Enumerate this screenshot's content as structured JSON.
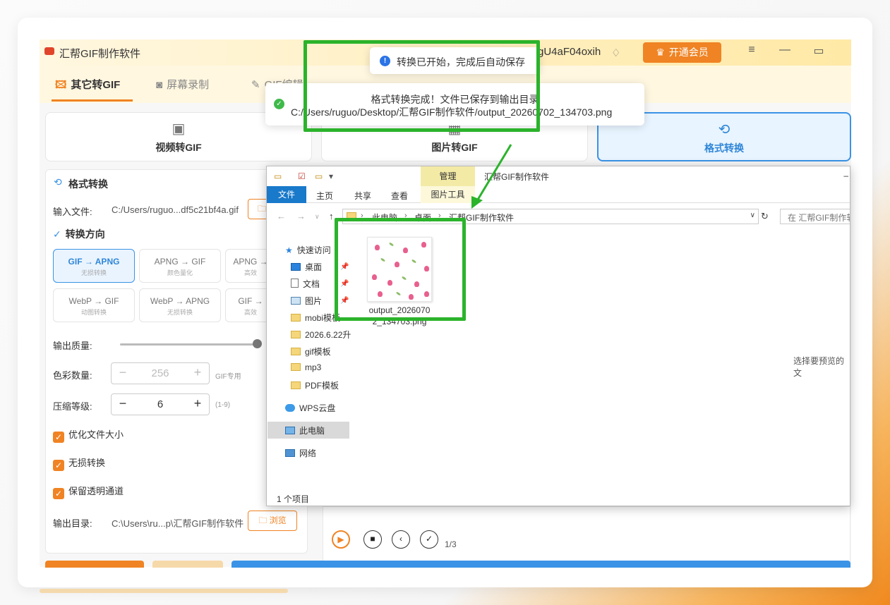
{
  "app": {
    "title": "汇帮GIF制作软件",
    "user_fragment": "gU4aF04oxih",
    "vip_label": "开通会员",
    "menu_icon": "hamburger-icon",
    "min_icon": "minimize-icon",
    "max_icon": "maximize-icon"
  },
  "tabs": [
    {
      "label": "其它转GIF",
      "icon": "image-icon"
    },
    {
      "label": "屏幕录制",
      "icon": "camera-icon"
    },
    {
      "label": "GIF编辑",
      "icon": "edit-icon"
    }
  ],
  "modes": [
    {
      "label": "视频转GIF",
      "icon": "film-icon"
    },
    {
      "label": "图片转GIF",
      "icon": "picture-icon"
    },
    {
      "label": "格式转换",
      "icon": "convert-icon"
    }
  ],
  "panel": {
    "title": "格式转换",
    "input_label": "输入文件:",
    "input_value": "C:/Users/ruguo...df5c21bf4a.gif",
    "direction_title": "转换方向",
    "options": [
      {
        "main": "GIF → APNG",
        "sub": "无损转换"
      },
      {
        "main": "APNG → GIF",
        "sub": "颜色量化"
      },
      {
        "main": "APNG →",
        "sub": "高效"
      },
      {
        "main": "WebP → GIF",
        "sub": "动图转换"
      },
      {
        "main": "WebP → APNG",
        "sub": "无损转换"
      },
      {
        "main": "GIF →",
        "sub": "高效"
      }
    ],
    "quality_label": "输出质量:",
    "quality_level": 0.97,
    "colors_label": "色彩数量:",
    "colors_value": "256",
    "colors_hint": "GIF专用",
    "compress_label": "压缩等级:",
    "compress_value": "6",
    "compress_hint": "(1-9)",
    "checks": [
      {
        "label": "优化文件大小"
      },
      {
        "label": "无损转换"
      },
      {
        "label": "保留透明通道"
      }
    ],
    "output_label": "输出目录:",
    "output_value": "C:\\Users\\ru...p\\汇帮GIF制作软件",
    "browse_label": "浏览"
  },
  "player": {
    "page": "1/3"
  },
  "toasts": {
    "start": "转换已开始，完成后自动保存",
    "done_line1": "格式转换完成！文件已保存到输出目录",
    "done_line2": "C:/Users/ruguo/Desktop/汇帮GIF制作软件/output_20260702_134703.png"
  },
  "explorer": {
    "title": "汇帮GIF制作软件",
    "manage": "管理",
    "ribbon": {
      "file": "文件",
      "home": "主页",
      "share": "共享",
      "view": "查看",
      "tools": "图片工具"
    },
    "crumbs": [
      "此电脑",
      "桌面",
      "汇帮GIF制作软件"
    ],
    "search_placeholder": "在 汇帮GIF制作软",
    "tree": {
      "quick_access": "快速访问",
      "desktop": "桌面",
      "documents": "文档",
      "pictures": "图片",
      "folder1": "mobi模板",
      "folder2": "2026.6.22升",
      "folder3": "gif模板",
      "folder4": "mp3",
      "folder5": "PDF模板",
      "cloud": "WPS云盘",
      "this_pc": "此电脑",
      "network": "网络"
    },
    "file_line1": "output_2026070",
    "file_line2": "2_134703.png",
    "preview_hint": "选择要预览的文",
    "status": "1 个项目"
  },
  "colors": {
    "accent": "#f08323",
    "highlight": "#2bb32b",
    "selected_blue": "#3a93e6"
  }
}
